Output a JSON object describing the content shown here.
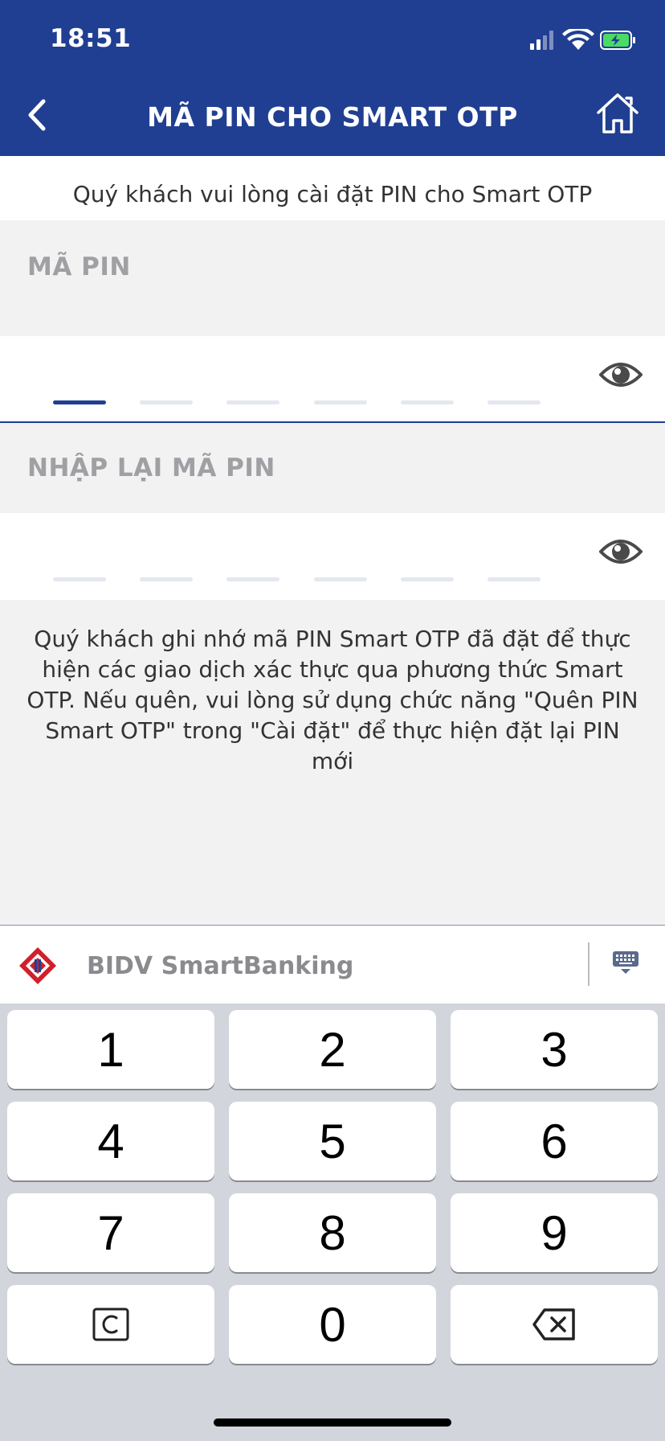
{
  "status_bar": {
    "time": "18:51"
  },
  "header": {
    "title": "MÃ PIN CHO SMART OTP"
  },
  "subtitle": "Quý khách vui lòng cài đặt PIN cho Smart OTP",
  "pin": {
    "label": "MÃ PIN",
    "length": 6,
    "active_index": 0
  },
  "confirm_pin": {
    "label": "NHẬP LẠI MÃ PIN",
    "length": 6
  },
  "note": "Quý khách ghi nhớ mã PIN Smart OTP đã đặt để thực hiện các giao dịch xác thực qua phương thức Smart OTP. Nếu quên, vui lòng sử dụng chức năng \"Quên PIN Smart OTP\" trong \"Cài đặt\" để thực hiện đặt lại PIN mới",
  "keyboard": {
    "title": "BIDV SmartBanking",
    "keys": [
      "1",
      "2",
      "3",
      "4",
      "5",
      "6",
      "7",
      "8",
      "9",
      "0"
    ]
  },
  "colors": {
    "brand": "#203f92",
    "logo_red": "#d0202a",
    "background": "#f2f2f2"
  }
}
